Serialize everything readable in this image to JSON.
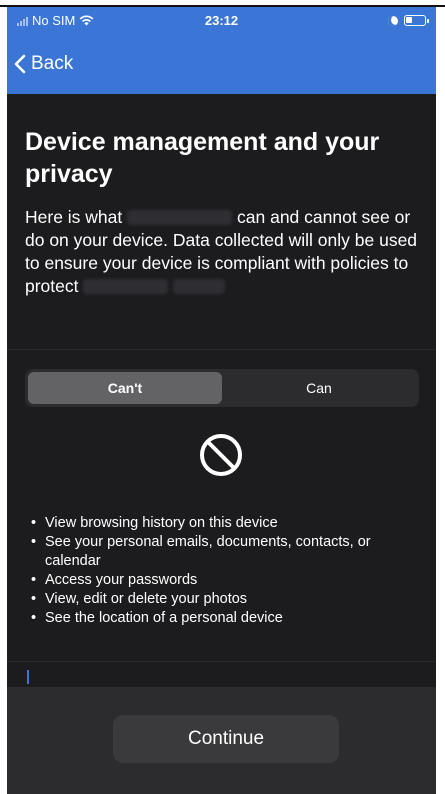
{
  "status_bar": {
    "carrier": "No SIM",
    "time": "23:12",
    "icons": [
      "signal-icon",
      "wifi-icon",
      "moon-icon",
      "battery-icon"
    ]
  },
  "nav": {
    "back_label": "Back",
    "back_icon": "chevron-left-icon"
  },
  "page": {
    "title": "Device management and your privacy",
    "intro_part1": "Here is what",
    "intro_part2": "can and cannot see or do on your device. Data collected will only be used to ensure your device is compliant with policies to protect"
  },
  "segmented": {
    "options": [
      "Can't",
      "Can"
    ],
    "selected": "Can't"
  },
  "cant_list": {
    "icon": "prohibited-icon",
    "items": [
      "View browsing history on this device",
      "See your personal emails, documents, contacts, or calendar",
      "Access your passwords",
      "View, edit or delete your photos",
      "See the location of a personal device"
    ]
  },
  "footer": {
    "continue_label": "Continue"
  },
  "colors": {
    "nav_background": "#3b76d6",
    "page_background": "#1c1c1e",
    "segment_active": "#636366",
    "button_background": "#3a3a3c"
  }
}
